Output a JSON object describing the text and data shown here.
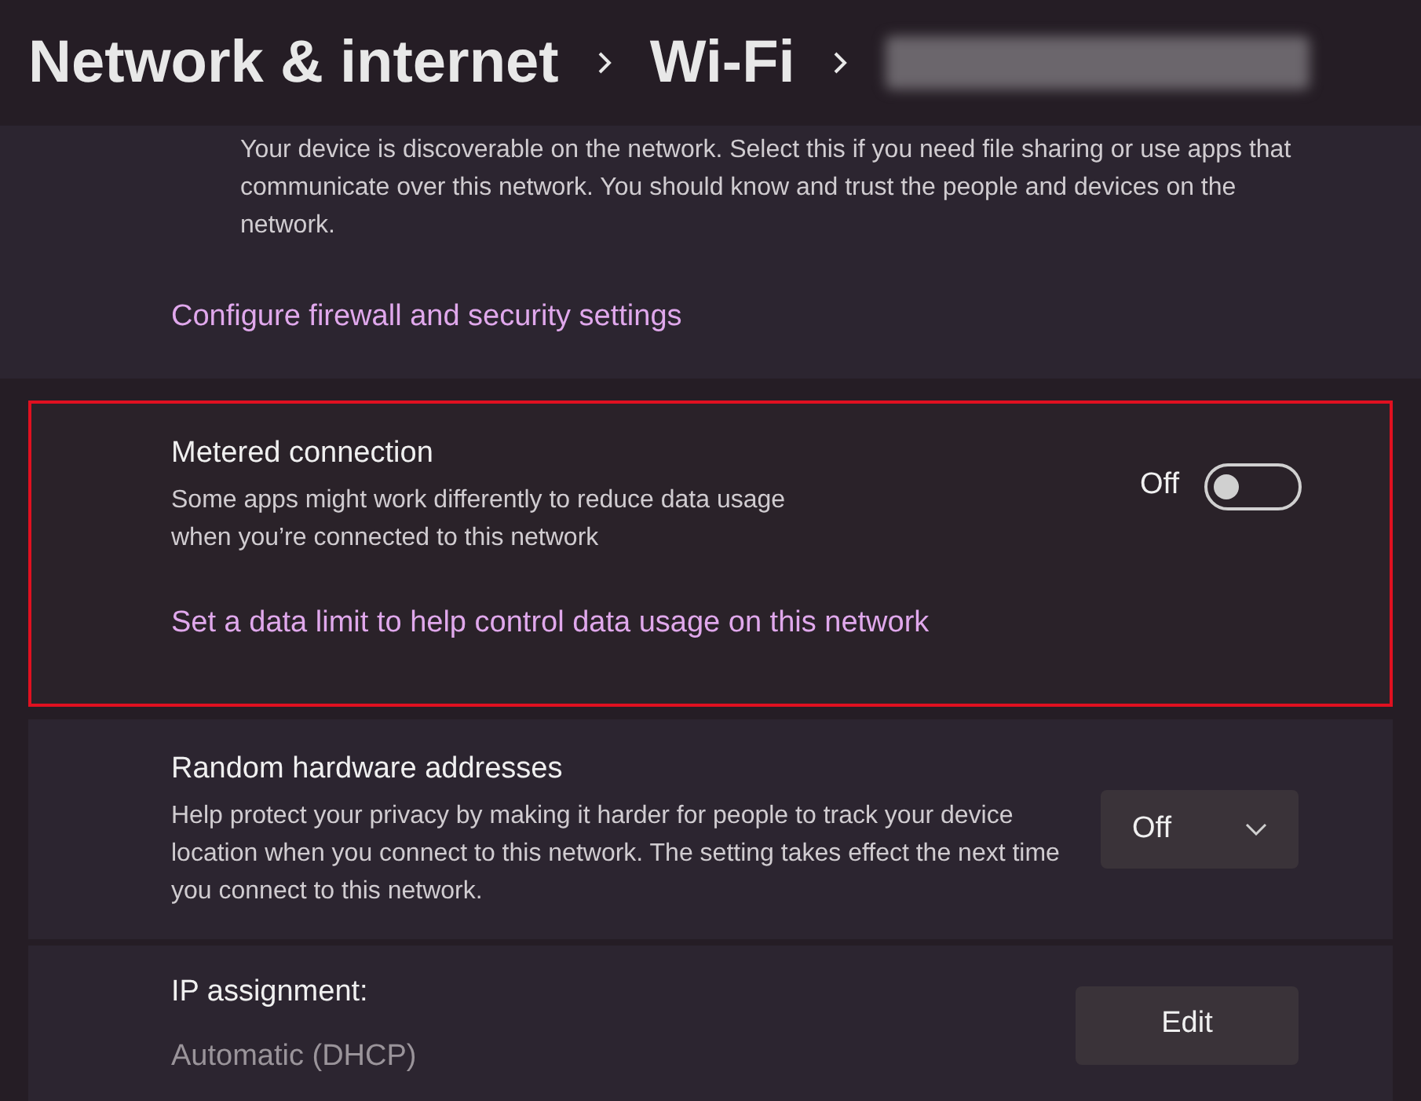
{
  "breadcrumb": [
    {
      "label": "Network & internet"
    },
    {
      "label": "Wi-Fi"
    }
  ],
  "discovery": {
    "description": "Your device is discoverable on the network. Select this if you need file sharing or use apps that communicate over this network. You should know and trust the people and devices on the network.",
    "link": "Configure firewall and security settings"
  },
  "metered": {
    "title": "Metered connection",
    "description": "Some apps might work differently to reduce data usage when you’re connected to this network",
    "state_label": "Off",
    "on": false,
    "link": "Set a data limit to help control data usage on this network",
    "highlighted": true
  },
  "random_addresses": {
    "title": "Random hardware addresses",
    "description": "Help protect your privacy by making it harder for people to track your device location when you connect to this network. The setting takes effect the next time you connect to this network.",
    "value": "Off"
  },
  "ip_assignment": {
    "title": "IP assignment:",
    "value": "Automatic (DHCP)",
    "button": "Edit"
  }
}
